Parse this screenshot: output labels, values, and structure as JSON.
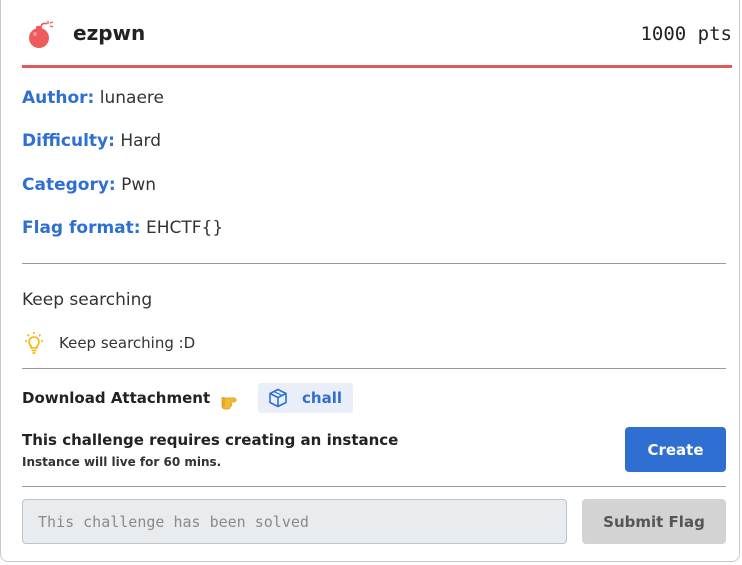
{
  "challenge": {
    "title": "ezpwn",
    "points": "1000 pts",
    "icon": "bomb-icon"
  },
  "meta": {
    "author_key": "Author:",
    "author_value": "lunaere",
    "difficulty_key": "Difficulty:",
    "difficulty_value": "Hard",
    "category_key": "Category:",
    "category_value": "Pwn",
    "flag_format_key": "Flag format:",
    "flag_format_value": "EHCTF{}"
  },
  "description": "Keep searching",
  "hint": {
    "icon": "lightbulb-icon",
    "text": "Keep searching :D"
  },
  "attachment": {
    "label": "Download Attachment",
    "pointer_icon": "pointing-hand-icon",
    "file_icon": "cube-icon",
    "file_name": "chall"
  },
  "instance": {
    "title": "This challenge requires creating an instance",
    "subtitle": "Instance will live for 60 mins.",
    "create_label": "Create"
  },
  "flag_form": {
    "placeholder": "This challenge has been solved",
    "value": "",
    "submit_label": "Submit Flag"
  },
  "colors": {
    "accent": "#2f6fd1",
    "header_underline": "#e05a5a",
    "bomb": "#ef5b5b",
    "bulb": "#f4b400"
  }
}
